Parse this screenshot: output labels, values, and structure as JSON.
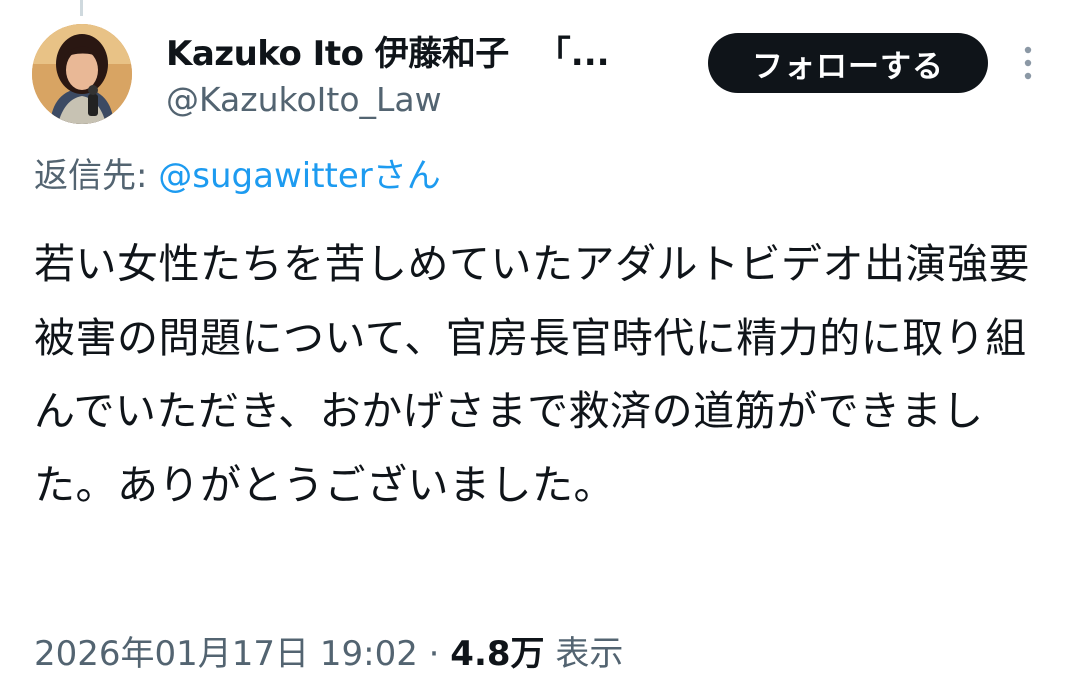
{
  "author": {
    "display_name": "Kazuko Ito 伊藤和子",
    "name_suffix": "「...",
    "handle": "@KazukoIto_Law"
  },
  "actions": {
    "follow_label": "フォローする",
    "more_icon": "more-vertical-icon"
  },
  "reply": {
    "prefix": "返信先: ",
    "to_handle": "@sugawitterさん"
  },
  "tweet": {
    "text": "若い女性たちを苦しめていたアダルトビデオ出演強要被害の問題について、官房長官時代に精力的に取り組んでいただき、おかげさまで救済の道筋ができました。ありがとうございました。"
  },
  "meta": {
    "timestamp": "2026年01月17日 19:02",
    "separator": " · ",
    "views_count": "4.8万",
    "views_label": " 表示"
  },
  "colors": {
    "text_primary": "#0f1419",
    "text_secondary": "#536471",
    "link": "#1d9bf0",
    "follow_bg": "#0f1419"
  }
}
